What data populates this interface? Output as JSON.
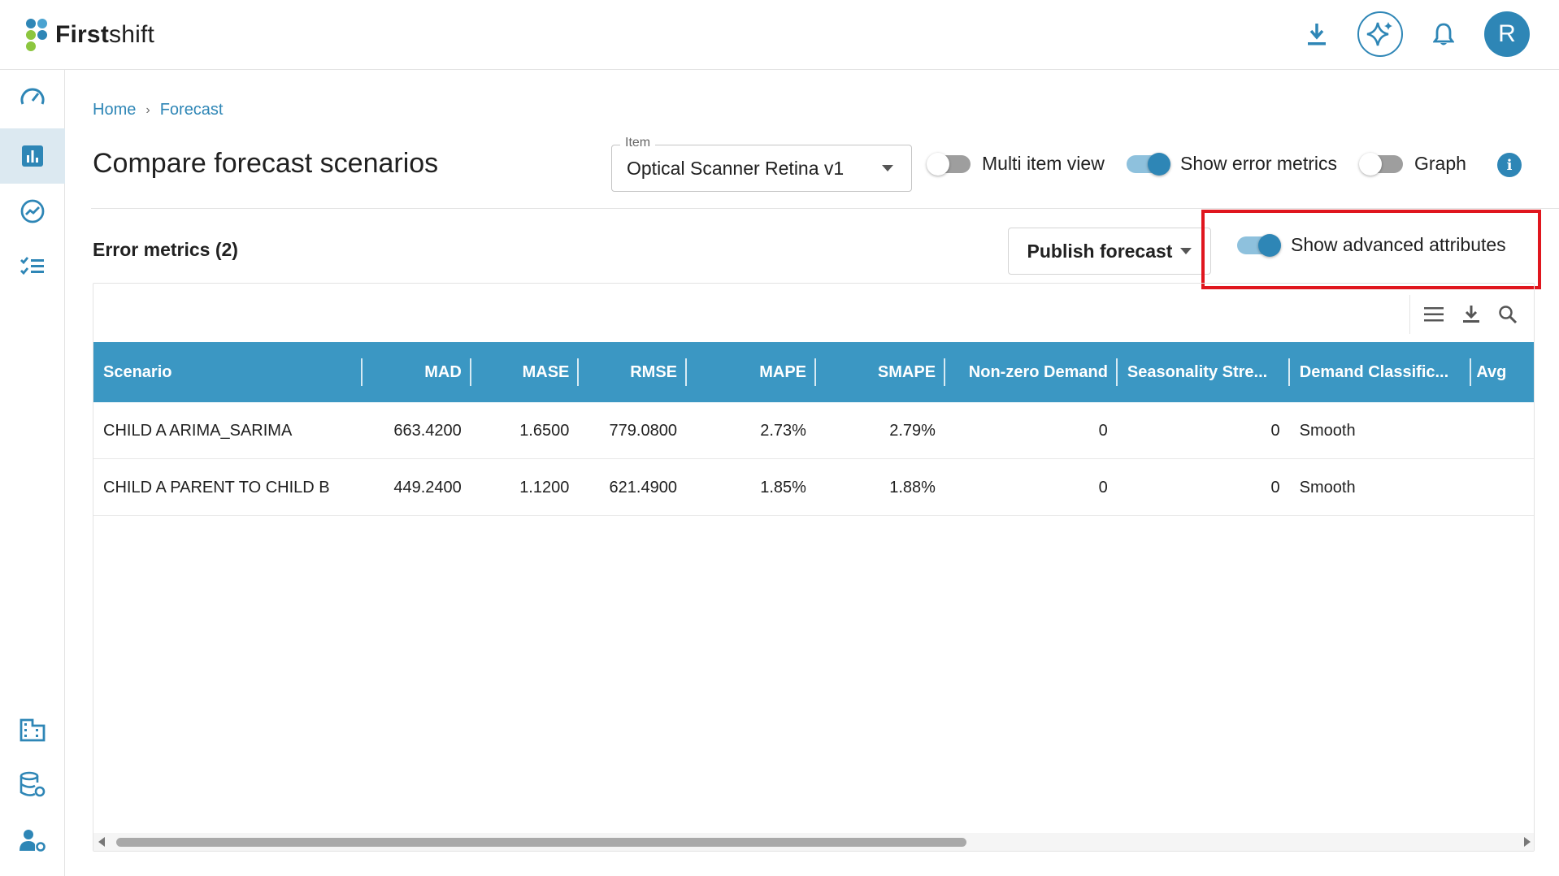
{
  "app": {
    "brand_bold": "First",
    "brand_light": "shift",
    "avatar_initial": "R",
    "accent_color": "#2e86b6"
  },
  "topbar_icons": [
    "download-icon",
    "sparkle-ai-icon",
    "bell-icon"
  ],
  "sidebar": {
    "items": [
      {
        "icon": "speedometer-icon",
        "active": false
      },
      {
        "icon": "bar-chart-icon",
        "active": true
      },
      {
        "icon": "trend-icon",
        "active": false
      },
      {
        "icon": "checklist-icon",
        "active": false
      },
      {
        "icon": "building-icon",
        "active": false
      },
      {
        "icon": "database-settings-icon",
        "active": false
      },
      {
        "icon": "user-settings-icon",
        "active": false
      }
    ]
  },
  "breadcrumb": {
    "home": "Home",
    "separator": "›",
    "current": "Forecast"
  },
  "page": {
    "title": "Compare forecast scenarios"
  },
  "item_select": {
    "label": "Item",
    "value": "Optical Scanner Retina v1"
  },
  "toggles": {
    "multi_item_view": {
      "label": "Multi item view",
      "on": false
    },
    "show_error_metrics": {
      "label": "Show error metrics",
      "on": true
    },
    "graph": {
      "label": "Graph",
      "on": false
    },
    "show_advanced_attributes": {
      "label": "Show advanced attributes",
      "on": true
    }
  },
  "section": {
    "title": "Error metrics (2)",
    "publish_label": "Publish forecast"
  },
  "grid": {
    "toolbar_icons": [
      "columns-menu-icon",
      "download-icon",
      "search-icon"
    ],
    "columns": [
      "Scenario",
      "MAD",
      "MASE",
      "RMSE",
      "MAPE",
      "SMAPE",
      "Non-zero Demand",
      "Seasonality Stre...",
      "Demand Classific...",
      "Avg"
    ],
    "rows": [
      [
        "CHILD A ARIMA_SARIMA",
        "663.4200",
        "1.6500",
        "779.0800",
        "2.73%",
        "2.79%",
        "0",
        "0",
        "Smooth",
        ""
      ],
      [
        "CHILD A PARENT TO CHILD B",
        "449.2400",
        "1.1200",
        "621.4900",
        "1.85%",
        "1.88%",
        "0",
        "0",
        "Smooth",
        ""
      ]
    ]
  }
}
